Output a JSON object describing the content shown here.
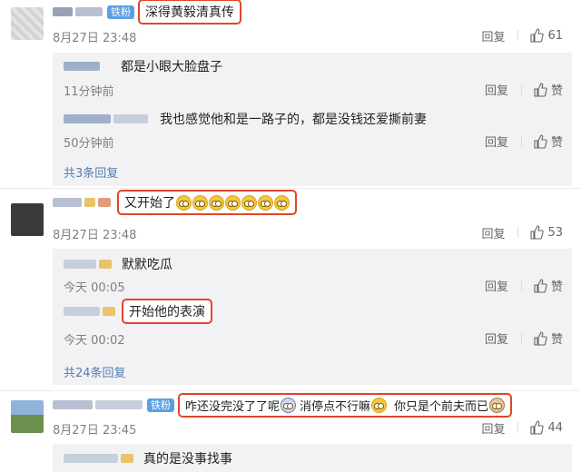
{
  "comments": [
    {
      "text": "深得黄毅清真传",
      "badge": "铁粉",
      "date": "8月27日 23:48",
      "reply_label": "回复",
      "likes": "61",
      "replies": [
        {
          "text": "都是小眼大脸盘子",
          "time": "11分钟前",
          "reply_label": "回复",
          "like_label": "赞"
        },
        {
          "text": "我也感觉他和是一路子的，都是没钱还爱撕前妻",
          "time": "50分钟前",
          "reply_label": "回复",
          "like_label": "赞"
        }
      ],
      "more": "共3条回复"
    },
    {
      "text": "又开始了",
      "date": "8月27日 23:48",
      "reply_label": "回复",
      "likes": "53",
      "replies": [
        {
          "text": "默默吃瓜",
          "time": "今天 00:05",
          "reply_label": "回复",
          "like_label": "赞"
        },
        {
          "text": "开始他的表演",
          "time": "今天 00:02",
          "reply_label": "回复",
          "like_label": "赞"
        }
      ],
      "more": "共24条回复"
    },
    {
      "text_a": "咋还没完没了了呢",
      "text_b": "消停点不行嘛",
      "text_c": "你只是个前夫而已",
      "badge": "铁粉",
      "date": "8月27日 23:45",
      "reply_label": "回复",
      "likes": "44",
      "replies": [
        {
          "text": "真的是没事找事"
        }
      ]
    }
  ],
  "colors": {
    "highlight_border": "#e0462c",
    "badge": "#5b9ee4",
    "link": "#507daf",
    "reply_bg": "#f2f2f5"
  },
  "icons": {
    "like": "thumbs-up-icon",
    "emoji": "face-emoji-icon"
  }
}
